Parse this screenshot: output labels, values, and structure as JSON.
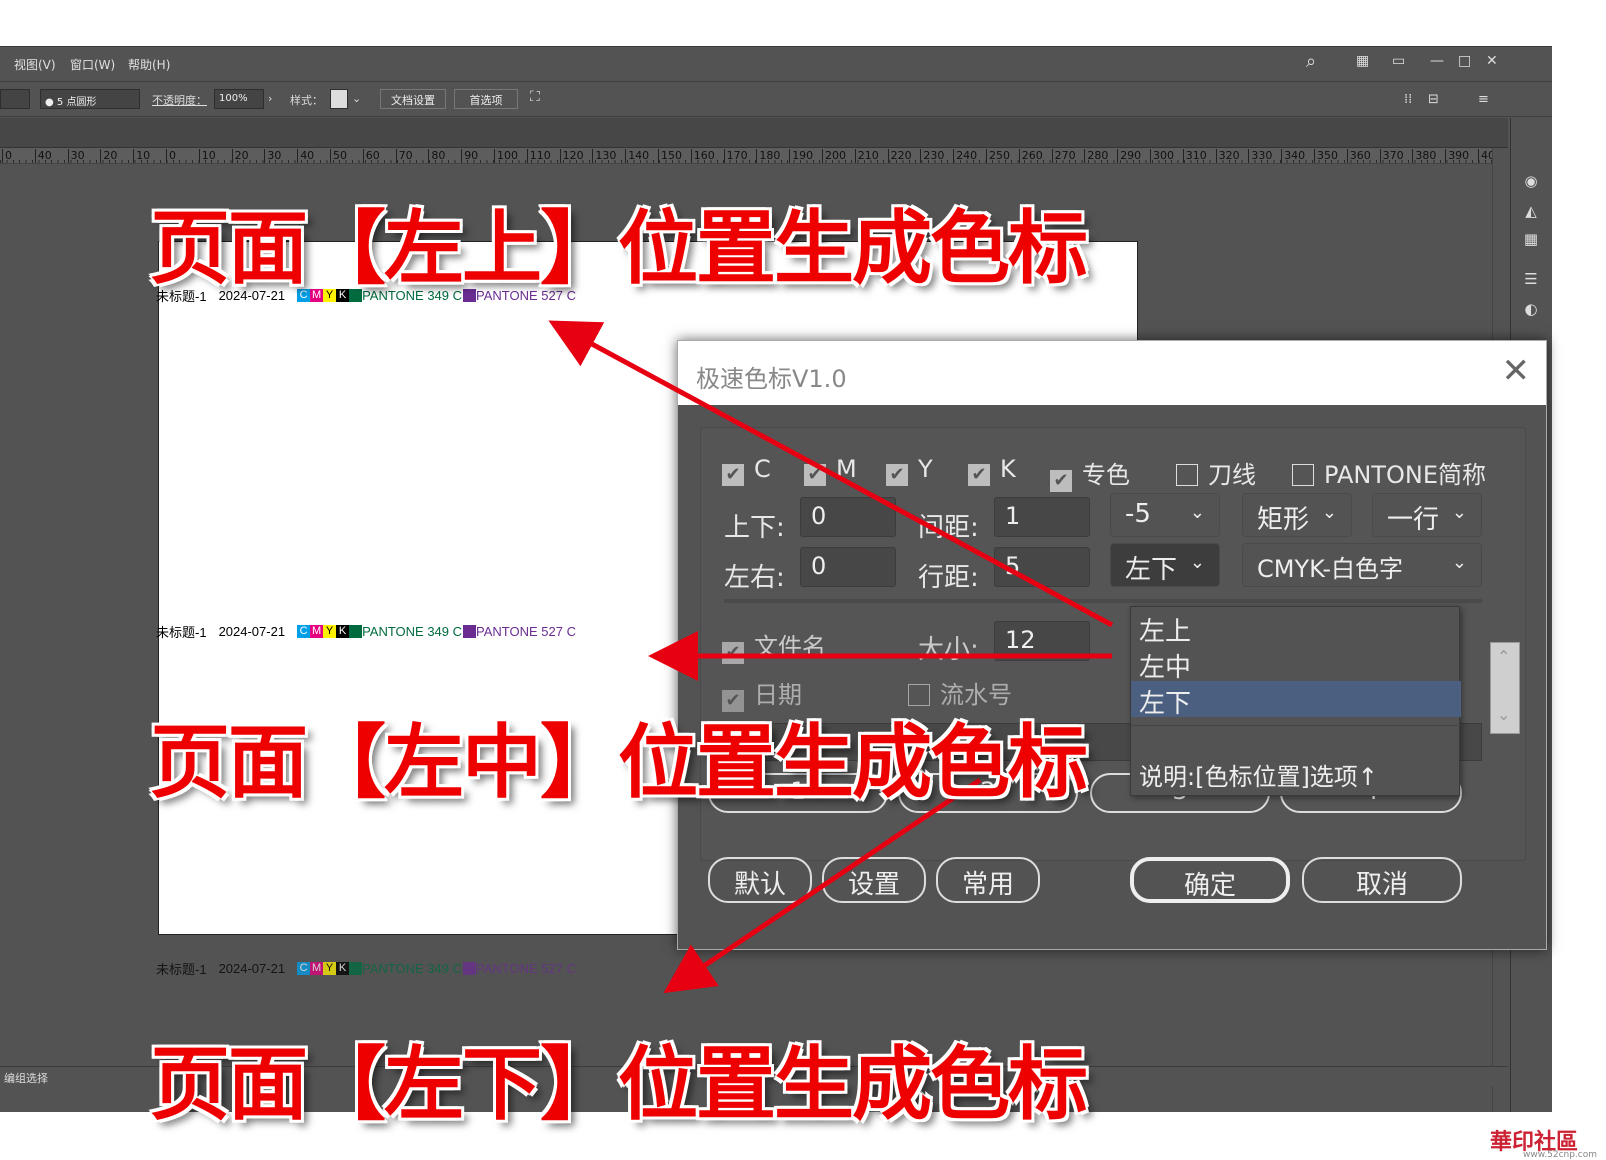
{
  "menu": {
    "view": "视图(V)",
    "window": "窗口(W)",
    "help": "帮助(H)"
  },
  "window_controls": {
    "min": "—",
    "max": "□",
    "close": "✕"
  },
  "control_bar": {
    "stroke_value": "● 5 点圆形",
    "opacity_label": "不透明度：",
    "opacity_value": "100%",
    "style_label": "样式：",
    "doc_setup": "文档设置",
    "preferences": "首选项"
  },
  "ruler": [
    "0",
    "40",
    "30",
    "20",
    "10",
    "0",
    "10",
    "20",
    "30",
    "40",
    "50",
    "60",
    "70",
    "80",
    "90",
    "100",
    "110",
    "120",
    "130",
    "140",
    "150",
    "160",
    "170",
    "180",
    "190",
    "200",
    "210",
    "220",
    "230",
    "240",
    "250",
    "260",
    "270",
    "280",
    "290",
    "300",
    "310",
    "320",
    "330",
    "340",
    "350",
    "360",
    "370",
    "380",
    "390",
    "40"
  ],
  "status": {
    "text": "编组选择"
  },
  "color_marks": {
    "filename": "未标题-1",
    "date": "2024-07-21",
    "c": "C",
    "m": "M",
    "y": "Y",
    "k": "K",
    "spot1": "PANTONE 349 C",
    "spot2": "PANTONE 527 C",
    "colors": {
      "c": "#00a0e9",
      "m": "#e4007f",
      "y": "#fff100",
      "k": "#000000",
      "spot1": "#006b3f",
      "spot2": "#6a2c91"
    }
  },
  "annotations": {
    "top": "页面【左上】位置生成色标",
    "middle": "页面【左中】位置生成色标",
    "bottom": "页面【左下】位置生成色标",
    "color": "#e60012"
  },
  "dialog": {
    "title": "极速色标V1.0",
    "close": "✕",
    "checks": {
      "c": "C",
      "m": "M",
      "y": "Y",
      "k": "K",
      "spot": "专色",
      "dieline": "刀线",
      "pantone_short": "PANTONE简称"
    },
    "updown_label": "上下:",
    "updown_value": "0",
    "spacing_label": "间距:",
    "spacing_value": "1",
    "leftright_label": "左右:",
    "leftright_value": "0",
    "linespace_label": "行距:",
    "linespace_value": "5",
    "offset_select": "-5",
    "shape_select": "矩形",
    "rows_select": "一行",
    "position_select": "左下",
    "mode_select": "CMYK-白色字",
    "filename_label": "文件名",
    "size_label": "大小:",
    "size_value": "12",
    "date_label": "日期",
    "serial_label": "流水号",
    "presets": [
      "1",
      "2",
      "3",
      "4"
    ],
    "btn_default": "默认",
    "btn_settings": "设置",
    "btn_common": "常用",
    "btn_ok": "确定",
    "btn_cancel": "取消"
  },
  "dropdown": {
    "items": [
      "左上",
      "左中",
      "左下"
    ],
    "selected": "左下",
    "note": "说明:[色标位置]选项↑"
  },
  "watermark": {
    "logo": "華印社區",
    "url": "www.52cnp.com"
  }
}
